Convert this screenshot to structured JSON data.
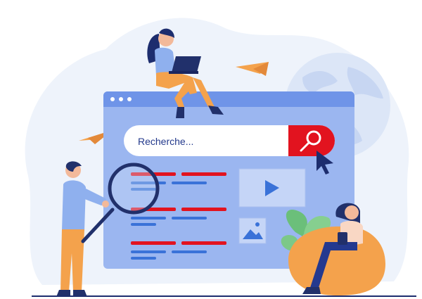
{
  "search": {
    "placeholder": "Recherche..."
  },
  "colors": {
    "background_blob": "#eef3fb",
    "browser_frame": "#6f94e8",
    "browser_body": "#9bb6f0",
    "search_bar": "#ffffff",
    "search_button": "#e2131f",
    "result_title": "#e2131f",
    "result_line": "#3a72d8",
    "media_tile": "#c5d5f7",
    "accent_orange": "#f4a24c",
    "navy": "#21306b"
  },
  "icons": {
    "search": "magnifier-icon",
    "cursor": "mouse-pointer-icon",
    "video": "play-icon",
    "image": "image-icon",
    "plane": "paper-plane-icon",
    "globe": "globe-icon",
    "laptop": "laptop-icon"
  }
}
